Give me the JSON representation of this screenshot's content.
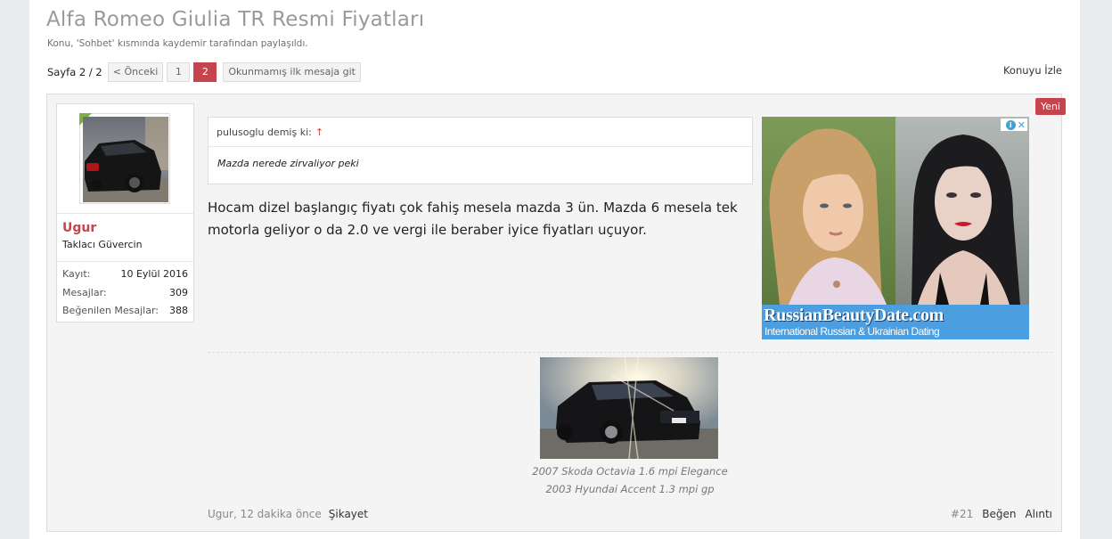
{
  "thread": {
    "title": "Alfa Romeo Giulia TR Resmi Fiyatları",
    "subtitle": "Konu, 'Sohbet' kısmında kaydemir tarafından paylaşıldı.",
    "watch_label": "Konuyu İzle"
  },
  "pagination": {
    "page_label": "Sayfa 2 / 2",
    "prev_label": "< Önceki",
    "pages": [
      "1",
      "2"
    ],
    "current": "2",
    "unread_label": "Okunmamış ilk mesaja git"
  },
  "post": {
    "badge": "Yeni",
    "user": {
      "name": "Ugur",
      "title": "Taklacı Güvercin",
      "online": true,
      "avatar": "car-photo",
      "stats": [
        {
          "label": "Kayıt:",
          "value": "10 Eylül 2016"
        },
        {
          "label": "Mesajlar:",
          "value": "309"
        },
        {
          "label": "Beğenilen Mesajlar:",
          "value": "388"
        }
      ]
    },
    "quote": {
      "author_line": "pulusoglu demiş ki:",
      "arrow": "↑",
      "text": "Mazda nerede zirvaliyor peki"
    },
    "message": "Hocam dizel başlangıç fiyatı çok fahiş mesela mazda 3 ün. Mazda 6 mesela tek motorla geliyor o da 2.0 ve vergi ile beraber iyice fiyatları uçuyor.",
    "ad": {
      "brand": "RussianBeautyDate.com",
      "tagline": "International Russian & Ukrainian Dating",
      "info_icon": "i",
      "close_icon": "✕",
      "banner_color": "#4b9edf"
    },
    "signature": {
      "image": "skoda-octavia-photo",
      "lines": [
        "2007 Skoda Octavia 1.6 mpi Elegance",
        "2003 Hyundai Accent 1.3 mpi gp"
      ]
    },
    "footer": {
      "author_time": "Ugur, 12 dakika önce",
      "report_label": "Şikayet",
      "post_number": "#21",
      "like_label": "Beğen",
      "quote_label": "Alıntı"
    }
  },
  "colors": {
    "accent": "#c5444d",
    "online": "#7ab342"
  }
}
